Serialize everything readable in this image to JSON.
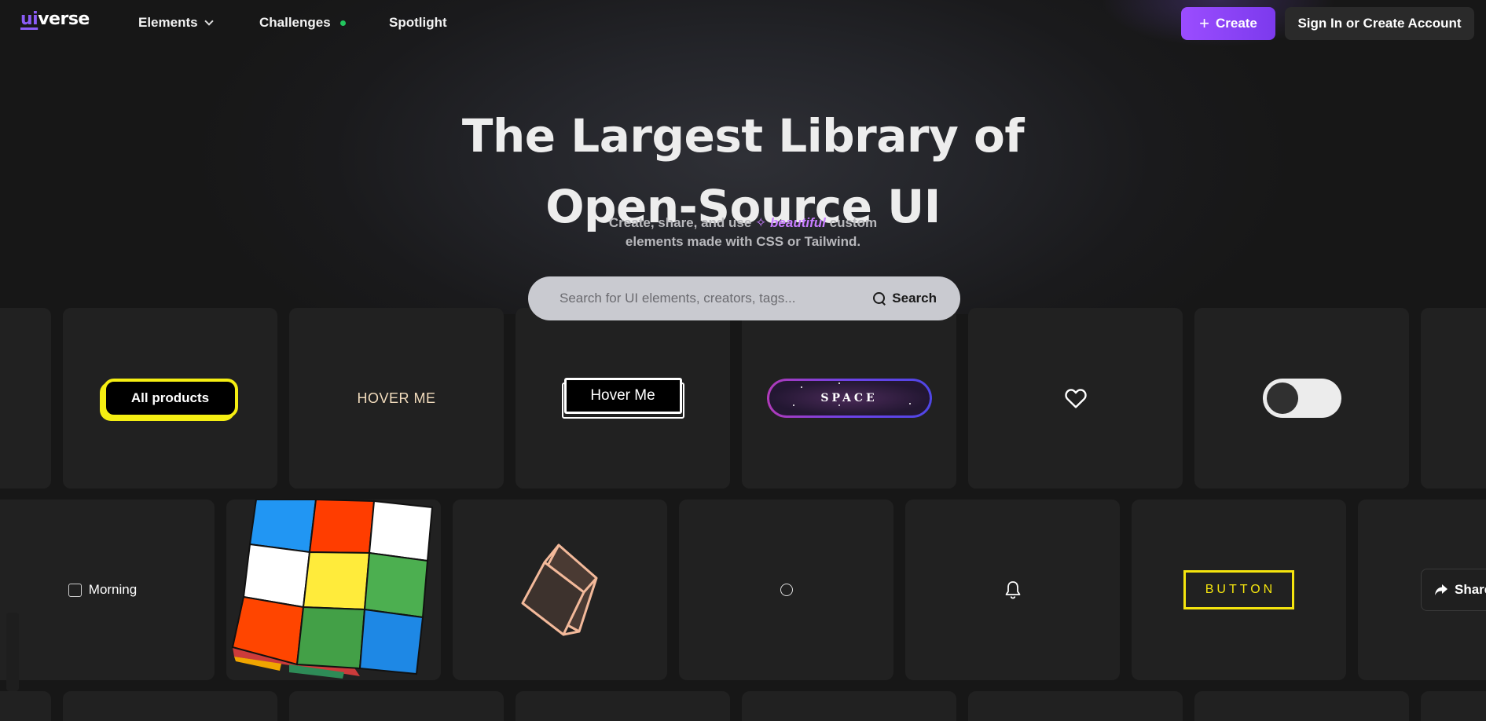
{
  "navbar": {
    "logo_ui": "ui",
    "logo_rest": "verse",
    "items": [
      {
        "label": "Elements"
      },
      {
        "label": "Challenges"
      },
      {
        "label": "Spotlight"
      }
    ],
    "create_label": "Create",
    "signin_label": "Sign In or Create Account"
  },
  "hero": {
    "title_line1": "The Largest Library of",
    "title_line2": "Open-Source UI",
    "sub_before": "Create, share, and use",
    "sub_highlight": "beautiful",
    "sub_after": "custom",
    "sub_line2": "elements made with CSS or Tailwind."
  },
  "search": {
    "placeholder": "Search for UI elements, creators, tags...",
    "button_label": "Search"
  },
  "cards_row1": {
    "all_products": "All products",
    "hover_me_plain": "HOVER ME",
    "hover_me_boxed": "Hover Me",
    "space": "SPACE"
  },
  "cards_row2": {
    "morning": "Morning",
    "button": "BUTTON"
  },
  "share": {
    "label": "Share"
  },
  "colors": {
    "accent": "#8b5cf6",
    "create_gradient_start": "#9b4dff",
    "highlight": "#c77dff",
    "yellow": "#f5ee12",
    "background": "#171717",
    "card": "#212121"
  }
}
